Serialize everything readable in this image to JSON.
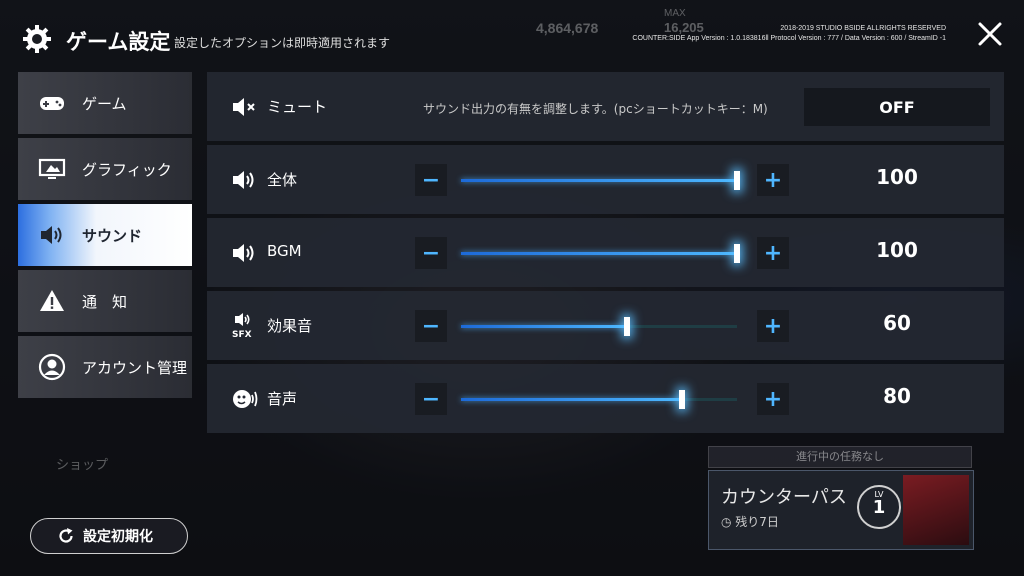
{
  "header": {
    "title": "ゲーム設定",
    "subtitle": "設定したオプションは即時適用されます",
    "copyright_line1": "2018-2019 STUDIO BSIDE ALLRIGHTS RESERVED",
    "copyright_line2": "COUNTER:SIDE App Version : 1.0.183816ll Protocol Version : 777 / Data Version : 600 / StreamID -1"
  },
  "background_hud": {
    "credit": "4,864,678",
    "max_label": "MAX",
    "stamina": "16,205",
    "shop_label": "ショップ",
    "mission_bar": "進行中の任務なし",
    "pass_title": "カウンターパス",
    "pass_days": "残り7日",
    "pass_lv_label": "LV",
    "pass_lv": "1"
  },
  "sidebar": {
    "items": [
      {
        "label": "ゲーム",
        "icon": "gamepad-icon",
        "active": false
      },
      {
        "label": "グラフィック",
        "icon": "monitor-icon",
        "active": false
      },
      {
        "label": "サウンド",
        "icon": "speaker-icon",
        "active": true
      },
      {
        "label": "通　知",
        "icon": "warning-icon",
        "active": false
      },
      {
        "label": "アカウント管理",
        "icon": "user-icon",
        "active": false
      }
    ]
  },
  "sound": {
    "mute": {
      "label": "ミュート",
      "description": "サウンド出力の有無を調整します。(pcショートカットキー：M)",
      "value": "OFF"
    },
    "master": {
      "label": "全体",
      "value": 100
    },
    "bgm": {
      "label": "BGM",
      "value": 100
    },
    "sfx": {
      "label": "効果音",
      "value": 60,
      "icon_text": "SFX"
    },
    "voice": {
      "label": "音声",
      "value": 80
    }
  },
  "reset_button": {
    "label": "設定初期化"
  },
  "colors": {
    "accent": "#4fb6ff",
    "active_tab": "#ffffff",
    "row_bg": "#242832"
  }
}
